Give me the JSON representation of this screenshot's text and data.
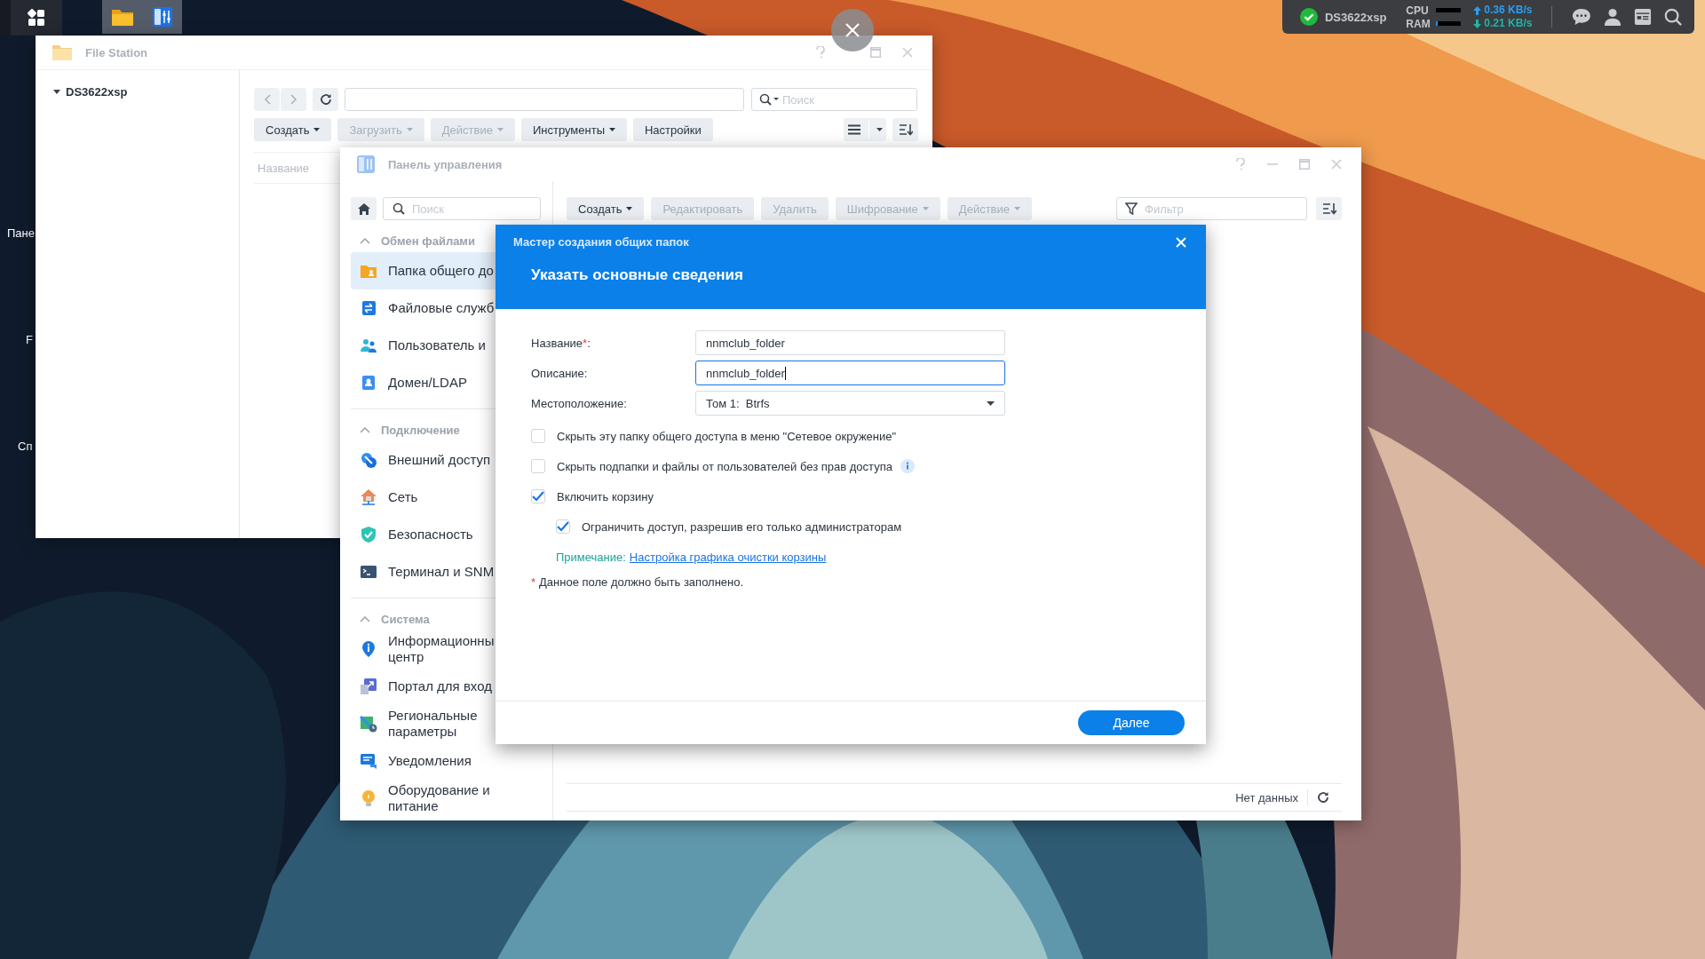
{
  "taskbar": {
    "apps": [
      {
        "kind": "file-station",
        "open": true
      },
      {
        "kind": "control-panel",
        "open": true
      }
    ]
  },
  "tray": {
    "healthy": true,
    "server": "DS3622xsp",
    "meters": [
      {
        "label": "CPU",
        "level": 0.0
      },
      {
        "label": "RAM",
        "level": 0.05
      }
    ],
    "upload": "0.36 KB/s",
    "download": "0.21 KB/s"
  },
  "desktop_labels": [
    "Пане",
    "F",
    "Сп"
  ],
  "file_station": {
    "title": "File Station",
    "tree": [
      {
        "label": "DS3622xsp",
        "expanded": true
      }
    ],
    "search": {
      "placeholder": "Поиск"
    },
    "buttons": [
      {
        "label": "Создать",
        "disabled": false,
        "menu": true
      },
      {
        "label": "Загрузить",
        "disabled": true,
        "menu": true
      },
      {
        "label": "Действие",
        "disabled": true,
        "menu": true
      },
      {
        "label": "Инструменты",
        "disabled": false,
        "menu": true
      },
      {
        "label": "Настройки",
        "disabled": false,
        "menu": false
      }
    ],
    "columns": [
      "Название"
    ]
  },
  "control_panel": {
    "title": "Панель управления",
    "search": {
      "placeholder": "Поиск"
    },
    "groups": [
      {
        "label": "Обмен файлами",
        "expanded": true,
        "items": [
          {
            "label": "Папка общего до",
            "kind": "folder",
            "selected": true
          },
          {
            "label": "Файловые служб",
            "kind": "services",
            "selected": false
          },
          {
            "label": "Пользователь и",
            "kind": "users",
            "selected": false
          },
          {
            "label": "Домен/LDAP",
            "kind": "domain",
            "selected": false
          }
        ]
      },
      {
        "label": "Подключение",
        "expanded": true,
        "items": [
          {
            "label": "Внешний доступ",
            "kind": "external",
            "selected": false
          },
          {
            "label": "Сеть",
            "kind": "network",
            "selected": false
          },
          {
            "label": "Безопасность",
            "kind": "security",
            "selected": false
          },
          {
            "label": "Терминал и SNM",
            "kind": "terminal",
            "selected": false
          }
        ]
      },
      {
        "label": "Система",
        "expanded": true,
        "items": [
          {
            "label": "Информационны центр",
            "kind": "info",
            "selected": false
          },
          {
            "label": "Портал для вход",
            "kind": "portal",
            "selected": false
          },
          {
            "label": "Региональные параметры",
            "kind": "regional",
            "selected": false
          },
          {
            "label": "Уведомления",
            "kind": "notifications",
            "selected": false
          },
          {
            "label": "Оборудование и питание",
            "kind": "hardware",
            "selected": false
          }
        ]
      }
    ],
    "buttons": [
      {
        "label": "Создать",
        "disabled": false,
        "menu": true
      },
      {
        "label": "Редактировать",
        "disabled": true,
        "menu": false
      },
      {
        "label": "Удалить",
        "disabled": true,
        "menu": false
      },
      {
        "label": "Шифрование",
        "disabled": true,
        "menu": true
      },
      {
        "label": "Действие",
        "disabled": true,
        "menu": true
      }
    ],
    "filter": {
      "placeholder": "Фильтр"
    },
    "status": "Нет данных"
  },
  "dialog": {
    "wizard": "Мастер создания общих папок",
    "heading": "Указать основные сведения",
    "fields": [
      {
        "kind": "text",
        "label": "Название",
        "required_mark": "*",
        "label_end": ":",
        "value": "nnmclub_folder",
        "focused": false
      },
      {
        "kind": "text",
        "label": "Описание:",
        "value": "nnmclub_folder",
        "focused": true
      },
      {
        "kind": "select",
        "label": "Местоположение:",
        "value": "Том 1:  Btrfs",
        "focused": false
      }
    ],
    "options": [
      {
        "label": "Скрыть эту папку общего доступа в меню \"Сетевое окружение\"",
        "checked": false,
        "info": false
      },
      {
        "label": "Скрыть подпапки и файлы от пользователей без прав доступа",
        "checked": false,
        "info": true
      },
      {
        "label": "Включить корзину",
        "checked": true,
        "info": false,
        "children": [
          {
            "label": "Ограничить доступ, разрешив его только администраторам",
            "checked": true,
            "info": false
          }
        ]
      }
    ],
    "note": {
      "label": "Примечание:",
      "link": "Настройка графика очистки корзины"
    },
    "required_note": {
      "mark": "*",
      "text": "Данное поле должно быть заполнено."
    },
    "next": "Далее"
  }
}
